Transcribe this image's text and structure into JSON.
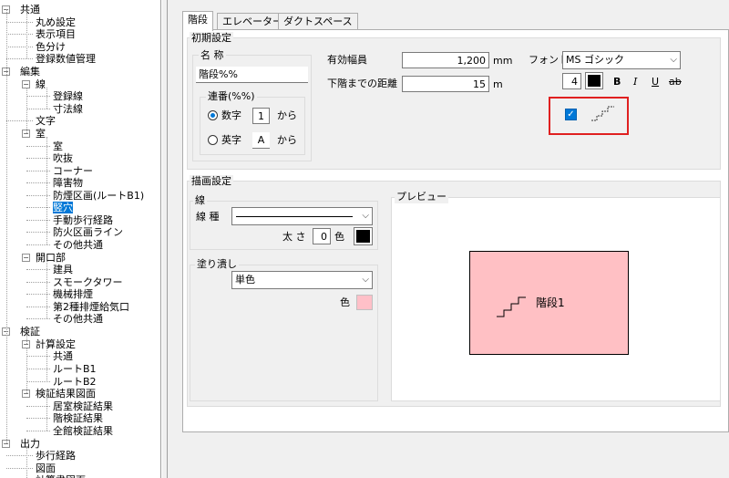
{
  "tree": {
    "items": [
      {
        "label": "共通"
      },
      {
        "label": "丸め設定"
      },
      {
        "label": "表示項目"
      },
      {
        "label": "色分け"
      },
      {
        "label": "登録数値管理"
      },
      {
        "label": "編集"
      },
      {
        "label": "線"
      },
      {
        "label": "登録線"
      },
      {
        "label": "寸法線"
      },
      {
        "label": "文字"
      },
      {
        "label": "室"
      },
      {
        "label": "室"
      },
      {
        "label": "吹抜"
      },
      {
        "label": "コーナー"
      },
      {
        "label": "障害物"
      },
      {
        "label": "防煙区画(ルートB1)"
      },
      {
        "label": "竪穴"
      },
      {
        "label": "手動歩行経路"
      },
      {
        "label": "防火区画ライン"
      },
      {
        "label": "その他共通"
      },
      {
        "label": "開口部"
      },
      {
        "label": "建具"
      },
      {
        "label": "スモークタワー"
      },
      {
        "label": "機械排煙"
      },
      {
        "label": "第2種排煙給気口"
      },
      {
        "label": "その他共通"
      },
      {
        "label": "検証"
      },
      {
        "label": "計算設定"
      },
      {
        "label": "共通"
      },
      {
        "label": "ルートB1"
      },
      {
        "label": "ルートB2"
      },
      {
        "label": "検証結果図面"
      },
      {
        "label": "居室検証結果"
      },
      {
        "label": "階検証結果"
      },
      {
        "label": "全館検証結果"
      },
      {
        "label": "出力"
      },
      {
        "label": "歩行経路"
      },
      {
        "label": "図面"
      },
      {
        "label": "計算書図面"
      }
    ],
    "expand_symbol": "−"
  },
  "tabs": [
    {
      "label": "階段"
    },
    {
      "label": "エレベーター"
    },
    {
      "label": "ダクトスペース"
    }
  ],
  "initial": {
    "title": "初期設定",
    "name_label": "名 称",
    "name_value": "階段%%",
    "serial": {
      "title": "連番(%%)",
      "numeric_label": "数字",
      "numeric_value": "1",
      "numeric_suffix": "から",
      "alpha_label": "英字",
      "alpha_value": "A",
      "alpha_suffix": "から",
      "selected": "numeric"
    },
    "width_label": "有効幅員",
    "width_value": "1,200",
    "width_unit": "mm",
    "dist_label": "下階までの距離",
    "dist_value": "15",
    "dist_unit": "m",
    "font_label": "フォント",
    "font_value": "MS ゴシック",
    "font_size": "4",
    "bold": "B",
    "italic": "I",
    "underline": "U",
    "strike": "ab",
    "show_stair_symbol": true,
    "highlight_color": "#e02020"
  },
  "draw": {
    "title": "描画設定",
    "line_group": "線",
    "line_type_label": "線 種",
    "thickness_label": "太 さ",
    "thickness_value": "0",
    "color_label": "色",
    "line_color": "#000000",
    "fill_group": "塗り潰し",
    "fill_value": "単色",
    "fill_color_label": "色",
    "fill_color": "#ffc0c8"
  },
  "preview": {
    "title": "プレビュー",
    "room_label": "階段1",
    "room_fill": "#ffc0c4"
  }
}
